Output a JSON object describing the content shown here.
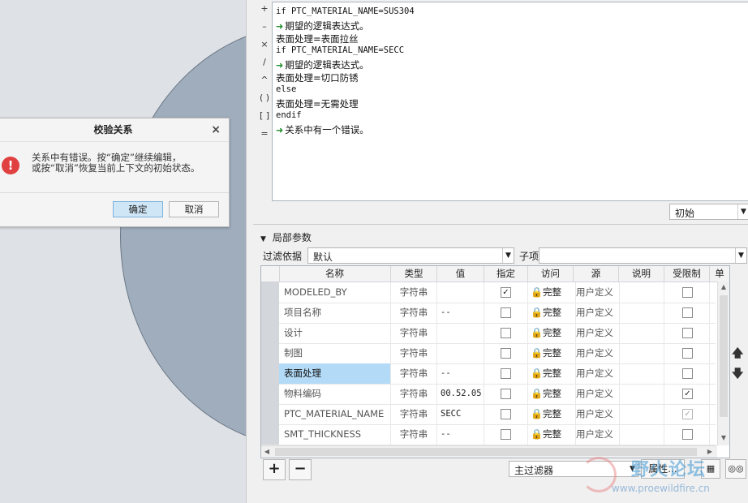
{
  "dialog": {
    "title": "校验关系",
    "close": "×",
    "error_glyph": "!",
    "message_line1": "关系中有错误。按“确定”继续编辑，",
    "message_line2": "或按“取消”恢复当前上下文的初始状态。",
    "ok_label": "确定",
    "cancel_label": "取消"
  },
  "operators": [
    "+",
    "–",
    "×",
    "/",
    "^",
    "( )",
    "[ ]",
    "="
  ],
  "editor": {
    "lines": [
      {
        "kind": "code",
        "text": "if PTC_MATERIAL_NAME=SUS304"
      },
      {
        "kind": "error",
        "text": "期望的逻辑表达式。"
      },
      {
        "kind": "text",
        "text": "表面处理=表面拉丝"
      },
      {
        "kind": "code",
        "text": "if PTC_MATERIAL_NAME=SECC"
      },
      {
        "kind": "error",
        "text": "期望的逻辑表达式。"
      },
      {
        "kind": "text",
        "text": "表面处理=切口防锈"
      },
      {
        "kind": "code",
        "text": "else"
      },
      {
        "kind": "text",
        "text": "表面处理=无需处理"
      },
      {
        "kind": "code",
        "text": "endif"
      },
      {
        "kind": "error",
        "text": "关系中有一个错误。"
      }
    ],
    "arrow_glyph": "➜"
  },
  "state_select": "初始",
  "local_params": {
    "header": "局部参数",
    "filter_label": "过滤依据",
    "filter_value": "默认",
    "child_label": "子项",
    "child_value": ""
  },
  "table": {
    "columns": [
      "名称",
      "类型",
      "值",
      "指定",
      "访问",
      "源",
      "说明",
      "受限制",
      "单"
    ],
    "rows": [
      {
        "name": "MODELED_BY",
        "type": "字符串",
        "value": "",
        "designated": true,
        "access": "完整",
        "source": "用户定义",
        "desc": "",
        "restricted": false,
        "restricted_disabled": false,
        "selected": false
      },
      {
        "name": "项目名称",
        "type": "字符串",
        "value": "--",
        "designated": false,
        "access": "完整",
        "source": "用户定义",
        "desc": "",
        "restricted": false,
        "restricted_disabled": false,
        "selected": false
      },
      {
        "name": "设计",
        "type": "字符串",
        "value": "",
        "designated": false,
        "access": "完整",
        "source": "用户定义",
        "desc": "",
        "restricted": false,
        "restricted_disabled": false,
        "selected": false
      },
      {
        "name": "制图",
        "type": "字符串",
        "value": "",
        "designated": false,
        "access": "完整",
        "source": "用户定义",
        "desc": "",
        "restricted": false,
        "restricted_disabled": false,
        "selected": false
      },
      {
        "name": "表面处理",
        "type": "字符串",
        "value": "--",
        "designated": false,
        "access": "完整",
        "source": "用户定义",
        "desc": "",
        "restricted": false,
        "restricted_disabled": false,
        "selected": true
      },
      {
        "name": "物料编码",
        "type": "字符串",
        "value": "00.52.05",
        "designated": false,
        "access": "完整",
        "source": "用户定义",
        "desc": "",
        "restricted": true,
        "restricted_disabled": false,
        "selected": false
      },
      {
        "name": "PTC_MATERIAL_NAME",
        "type": "字符串",
        "value": "SECC",
        "designated": false,
        "access": "完整",
        "source": "用户定义",
        "desc": "",
        "restricted": true,
        "restricted_disabled": true,
        "selected": false
      },
      {
        "name": "SMT_THICKNESS",
        "type": "字符串",
        "value": "--",
        "designated": false,
        "access": "完整",
        "source": "用户定义",
        "desc": "",
        "restricted": false,
        "restricted_disabled": false,
        "selected": false
      }
    ],
    "check_glyph": "✓",
    "lock_glyph": "🔒"
  },
  "bottom": {
    "add": "+",
    "remove": "−",
    "main_filter": "主过滤器",
    "properties": "属性..."
  },
  "watermark": {
    "text": "野火论坛",
    "url": "www.proewildfire.cn"
  }
}
